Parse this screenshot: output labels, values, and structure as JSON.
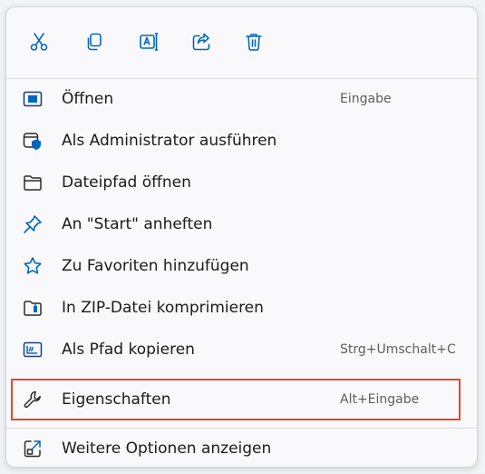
{
  "toolbar": {
    "icons": [
      "cut-icon",
      "copy-icon",
      "rename-icon",
      "share-icon",
      "delete-icon"
    ]
  },
  "items": [
    {
      "label": "Öffnen",
      "shortcut": "Eingabe",
      "icon": "open-icon"
    },
    {
      "label": "Als Administrator ausführen",
      "shortcut": "",
      "icon": "shield-icon"
    },
    {
      "label": "Dateipfad öffnen",
      "shortcut": "",
      "icon": "folder-icon"
    },
    {
      "label": "An \"Start\" anheften",
      "shortcut": "",
      "icon": "pin-icon"
    },
    {
      "label": "Zu Favoriten hinzufügen",
      "shortcut": "",
      "icon": "star-icon"
    },
    {
      "label": "In ZIP-Datei komprimieren",
      "shortcut": "",
      "icon": "zip-folder-icon"
    },
    {
      "label": "Als Pfad kopieren",
      "shortcut": "Strg+Umschalt+C",
      "icon": "copy-path-icon"
    },
    {
      "label": "Eigenschaften",
      "shortcut": "Alt+Eingabe",
      "icon": "wrench-icon"
    }
  ],
  "footer": {
    "label": "Weitere Optionen anzeigen",
    "icon": "more-options-icon"
  },
  "colors": {
    "accent": "#0067c0",
    "highlight_border": "#e8472b"
  }
}
